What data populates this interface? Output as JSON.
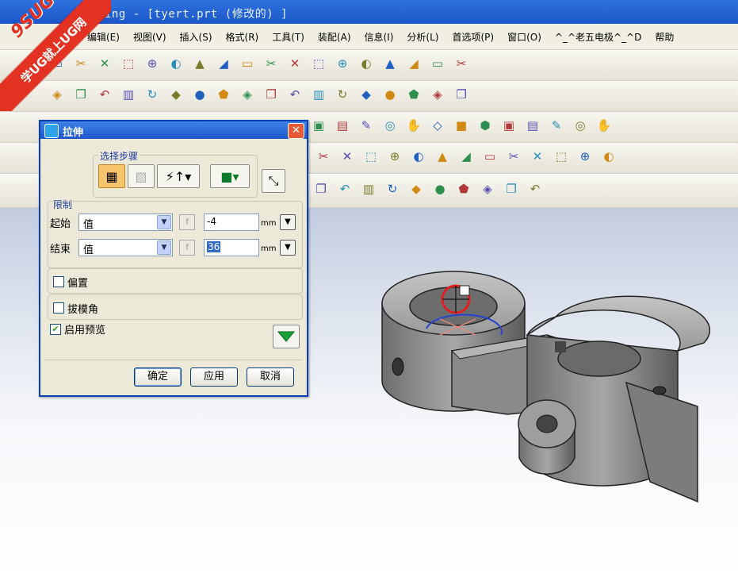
{
  "window": {
    "title": "ing - [tyert.prt (修改的) ]"
  },
  "watermark": {
    "brand": "9SUG",
    "slogan": "学UG就上UG网"
  },
  "menu": [
    "编辑(E)",
    "视图(V)",
    "插入(S)",
    "格式(R)",
    "工具(T)",
    "装配(A)",
    "信息(I)",
    "分析(L)",
    "首选项(P)",
    "窗口(O)",
    "^_^老五电极^_^D",
    "帮助"
  ],
  "toolbars": [
    {
      "icons": [
        "new-file-icon",
        "open-folder-icon",
        "save-icon",
        "cut-icon",
        "copy-icon",
        "paste-icon",
        "delete-icon",
        "undo-icon",
        "brush-icon",
        "select-icon",
        "fit-icon",
        "zoom-box-icon",
        "zoom-icon",
        "rotate-icon",
        "pan-icon",
        "shade-icon",
        "view-cube-icon",
        "box-view-icon"
      ]
    },
    {
      "icons": [
        "extrude-icon",
        "revolve-icon",
        "sweep-icon",
        "tube-icon",
        "feature-icon",
        "boss-icon",
        "pocket-icon",
        "pad-icon",
        "slot-icon",
        "groove-icon",
        "cylinder-icon",
        "cone-icon",
        "sketch-icon",
        "curve-icon",
        "edge-icon",
        "surface-icon",
        "body-icon",
        "box-icon"
      ]
    },
    {
      "icons": [
        "pad2-icon",
        "cylinder2-icon",
        "hole-icon",
        "boss2-icon",
        "blend-icon",
        "chamfer-icon",
        "shell-icon",
        "offset-icon",
        "draft-icon",
        "trim-icon",
        "split-icon",
        "sew-icon",
        "patch-icon"
      ]
    },
    {
      "icons": [
        "rectangle-icon",
        "polygon-icon",
        "circle-icon",
        "arc-icon",
        "cross-icon",
        "spline-icon",
        "helix-icon",
        "face-icon",
        "law-icon",
        "section-icon",
        "bridge-icon",
        "combine-icon",
        "project-icon"
      ]
    },
    {
      "icons": [
        "assembly-icon",
        "component-icon",
        "constraint-icon",
        "mate-icon",
        "triangle-icon",
        "texture-icon",
        "text-icon",
        "point-icon",
        "hole2-icon",
        "layer-icon"
      ]
    }
  ],
  "dialog": {
    "title": "拉伸",
    "steps_label": "选择步骤",
    "limits_label": "限制",
    "start": {
      "label": "起始",
      "mode": "值",
      "value": "-4",
      "unit": "mm"
    },
    "end": {
      "label": "结束",
      "mode": "值",
      "value": "36",
      "unit": "mm"
    },
    "offset": {
      "label": "偏置",
      "checked": false
    },
    "draft": {
      "label": "拔模角",
      "checked": false
    },
    "preview": {
      "label": "启用预览",
      "checked": true
    },
    "buttons": {
      "ok": "确定",
      "apply": "应用",
      "cancel": "取消"
    }
  }
}
